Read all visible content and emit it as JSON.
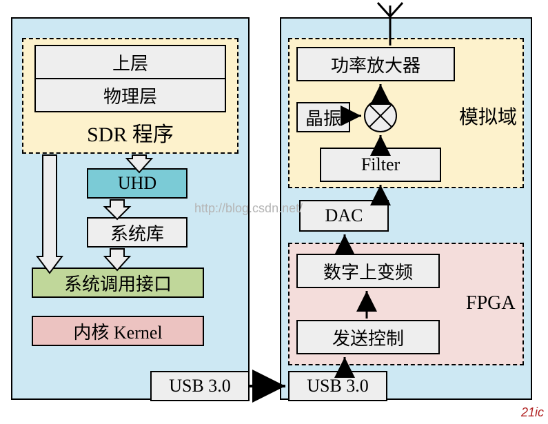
{
  "left": {
    "sdr_upper": "上层",
    "sdr_phy": "物理层",
    "sdr_program": "SDR 程序",
    "uhd": "UHD",
    "syslib": "系统库",
    "syscall": "系统调用接口",
    "kernel": "内核 Kernel",
    "usb": "USB 3.0"
  },
  "right": {
    "pa": "功率放大器",
    "osc": "晶振",
    "analog_domain": "模拟域",
    "filter": "Filter",
    "dac": "DAC",
    "duc": "数字上变频",
    "txctrl": "发送控制",
    "fpga": "FPGA",
    "usb": "USB 3.0"
  },
  "watermark": "http://blog.csdn.net/",
  "corner": "21ic"
}
